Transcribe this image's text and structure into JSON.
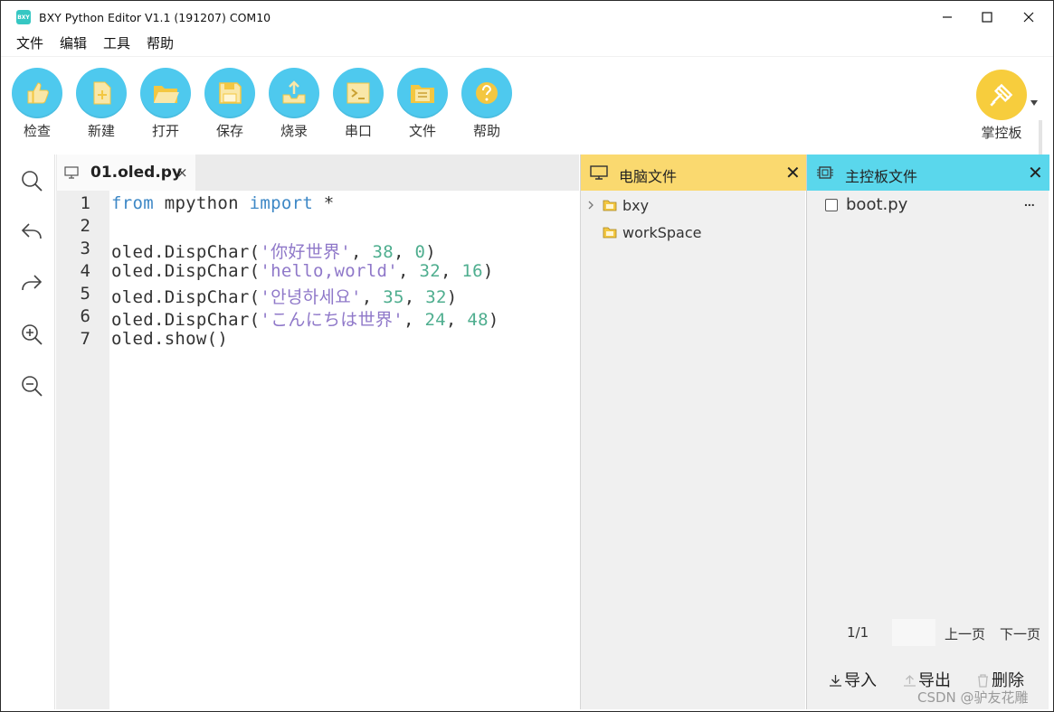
{
  "window": {
    "logo_text": "BXY",
    "title": "BXY Python Editor V1.1 (191207) COM10"
  },
  "menu": [
    "文件",
    "编辑",
    "工具",
    "帮助"
  ],
  "toolbar": {
    "items": [
      {
        "label": "检查",
        "icon": "thumbs-up-icon"
      },
      {
        "label": "新建",
        "icon": "new-file-icon"
      },
      {
        "label": "打开",
        "icon": "open-folder-icon"
      },
      {
        "label": "保存",
        "icon": "save-icon"
      },
      {
        "label": "烧录",
        "icon": "upload-tray-icon"
      },
      {
        "label": "串口",
        "icon": "terminal-icon"
      },
      {
        "label": "文件",
        "icon": "file-folder-icon"
      },
      {
        "label": "帮助",
        "icon": "question-icon"
      }
    ],
    "board_label": "掌控板",
    "accent": "#4ec9ee",
    "board_color": "#f7cd3d"
  },
  "sidebar": [
    "search-icon",
    "undo-icon",
    "redo-icon",
    "zoom-in-icon",
    "zoom-out-icon"
  ],
  "editor": {
    "tab_title": "01.oled.py",
    "tab_close": "×",
    "line_numbers": [
      "1",
      "2",
      "3",
      "4",
      "5",
      "6",
      "7"
    ],
    "lines": [
      [
        {
          "t": "from",
          "c": "kw"
        },
        {
          "t": " mpython ",
          "c": ""
        },
        {
          "t": "import",
          "c": "kw"
        },
        {
          "t": " *",
          "c": ""
        }
      ],
      [],
      [
        {
          "t": "oled.DispChar(",
          "c": ""
        },
        {
          "t": "'你好世界'",
          "c": "str"
        },
        {
          "t": ", ",
          "c": ""
        },
        {
          "t": "38",
          "c": "num"
        },
        {
          "t": ", ",
          "c": ""
        },
        {
          "t": "0",
          "c": "num"
        },
        {
          "t": ")",
          "c": ""
        }
      ],
      [
        {
          "t": "oled.DispChar(",
          "c": ""
        },
        {
          "t": "'hello,world'",
          "c": "str"
        },
        {
          "t": ", ",
          "c": ""
        },
        {
          "t": "32",
          "c": "num"
        },
        {
          "t": ", ",
          "c": ""
        },
        {
          "t": "16",
          "c": "num"
        },
        {
          "t": ")",
          "c": ""
        }
      ],
      [
        {
          "t": "oled.DispChar(",
          "c": ""
        },
        {
          "t": "'안녕하세요'",
          "c": "str"
        },
        {
          "t": ", ",
          "c": ""
        },
        {
          "t": "35",
          "c": "num"
        },
        {
          "t": ", ",
          "c": ""
        },
        {
          "t": "32",
          "c": "num"
        },
        {
          "t": ")",
          "c": ""
        }
      ],
      [
        {
          "t": "oled.DispChar(",
          "c": ""
        },
        {
          "t": "'こんにちは世界'",
          "c": "str"
        },
        {
          "t": ", ",
          "c": ""
        },
        {
          "t": "24",
          "c": "num"
        },
        {
          "t": ", ",
          "c": ""
        },
        {
          "t": "48",
          "c": "num"
        },
        {
          "t": ")",
          "c": ""
        }
      ],
      [
        {
          "t": "oled.show()",
          "c": ""
        }
      ]
    ]
  },
  "pc_files": {
    "title": "电脑文件",
    "close": "✕",
    "header_color": "#fad96f",
    "items": [
      {
        "name": "bxy",
        "expandable": true
      },
      {
        "name": "workSpace",
        "expandable": false
      }
    ]
  },
  "board_files": {
    "title": "主控板文件",
    "close": "✕",
    "header_color": "#5ad7ec",
    "files": [
      {
        "name": "boot.py",
        "more": "..."
      }
    ],
    "page": "1/1",
    "prev": "上一页",
    "next": "下一页",
    "actions": {
      "import": "导入",
      "export": "导出",
      "delete": "删除"
    }
  },
  "watermark": "CSDN @驴友花雕"
}
